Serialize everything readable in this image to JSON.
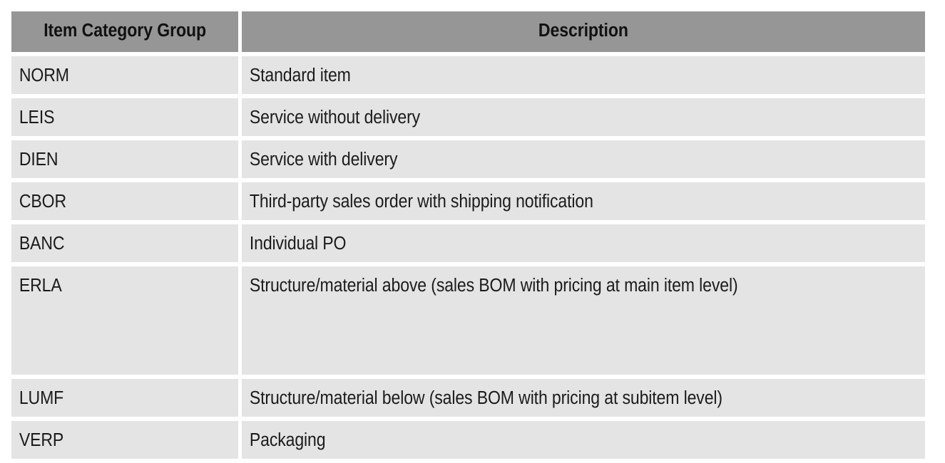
{
  "page": {
    "background_color": "#ffffff",
    "header_background_color": "#969696",
    "row_background_color": "#e4e4e4",
    "text_color": "#1b1b1b"
  },
  "table": {
    "columns": [
      {
        "key": "code",
        "label": "Item Category Group"
      },
      {
        "key": "description",
        "label": "Description"
      }
    ],
    "rows": [
      {
        "code": "NORM",
        "description": "Standard item"
      },
      {
        "code": "LEIS",
        "description": "Service without delivery"
      },
      {
        "code": "DIEN",
        "description": "Service with delivery"
      },
      {
        "code": "CBOR",
        "description": "Third-party sales order with shipping notification"
      },
      {
        "code": "BANC",
        "description": "Individual PO"
      },
      {
        "code": "ERLA",
        "description": "Structure/material above (sales BOM with pricing at main item level)"
      },
      {
        "code": "LUMF",
        "description": "Structure/material below (sales BOM with pricing at subitem level)"
      },
      {
        "code": "VERP",
        "description": "Packaging"
      }
    ]
  }
}
